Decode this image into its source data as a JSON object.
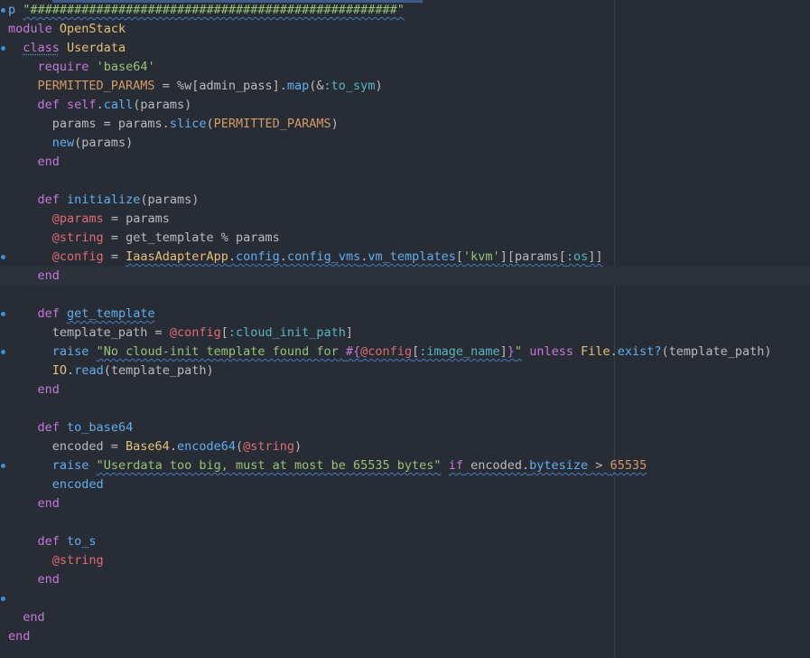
{
  "editor": {
    "language": "ruby",
    "colors": {
      "background": "#282c34",
      "keyword": "#c678dd",
      "string": "#98c379",
      "constant": "#d19a66",
      "class": "#e5c07b",
      "method": "#61afef",
      "ivar": "#e06c75",
      "symbol": "#56b6c2",
      "plain": "#bbbbbb",
      "gutter_marker": "#3d8fdb"
    },
    "lines": [
      {
        "t": [
          {
            "c": "fn",
            "v": "p"
          },
          {
            "c": "plain",
            "v": " "
          },
          {
            "c": "str",
            "v": "\"##################################################\""
          }
        ]
      },
      {
        "t": [
          {
            "c": "kw",
            "v": "module"
          },
          {
            "c": "plain",
            "v": " "
          },
          {
            "c": "cls",
            "v": "OpenStack"
          }
        ]
      },
      {
        "t": [
          {
            "c": "plain",
            "v": "  "
          },
          {
            "c": "kw",
            "v": "class"
          },
          {
            "c": "plain",
            "v": " "
          },
          {
            "c": "cls",
            "v": "Userdata"
          }
        ]
      },
      {
        "t": [
          {
            "c": "plain",
            "v": "    "
          },
          {
            "c": "kw",
            "v": "require"
          },
          {
            "c": "plain",
            "v": " "
          },
          {
            "c": "str",
            "v": "'base64'"
          }
        ]
      },
      {
        "t": [
          {
            "c": "plain",
            "v": "    "
          },
          {
            "c": "const",
            "v": "PERMITTED_PARAMS"
          },
          {
            "c": "plain",
            "v": " = %w["
          },
          {
            "c": "plain",
            "v": "admin_pass"
          },
          {
            "c": "plain",
            "v": "]."
          },
          {
            "c": "fn",
            "v": "map"
          },
          {
            "c": "plain",
            "v": "(&"
          },
          {
            "c": "sym",
            "v": ":to_sym"
          },
          {
            "c": "plain",
            "v": ")"
          }
        ]
      },
      {
        "t": [
          {
            "c": "plain",
            "v": "    "
          },
          {
            "c": "kw",
            "v": "def"
          },
          {
            "c": "plain",
            "v": " "
          },
          {
            "c": "kw",
            "v": "self"
          },
          {
            "c": "plain",
            "v": "."
          },
          {
            "c": "fn",
            "v": "call"
          },
          {
            "c": "plain",
            "v": "(params)"
          }
        ]
      },
      {
        "t": [
          {
            "c": "plain",
            "v": "      params = params."
          },
          {
            "c": "fn",
            "v": "slice"
          },
          {
            "c": "plain",
            "v": "("
          },
          {
            "c": "const",
            "v": "PERMITTED_PARAMS"
          },
          {
            "c": "plain",
            "v": ")"
          }
        ]
      },
      {
        "t": [
          {
            "c": "plain",
            "v": "      "
          },
          {
            "c": "fn",
            "v": "new"
          },
          {
            "c": "plain",
            "v": "(params)"
          }
        ]
      },
      {
        "t": [
          {
            "c": "plain",
            "v": "    "
          },
          {
            "c": "kw",
            "v": "end"
          }
        ]
      },
      {
        "t": []
      },
      {
        "t": [
          {
            "c": "plain",
            "v": "    "
          },
          {
            "c": "kw",
            "v": "def"
          },
          {
            "c": "plain",
            "v": " "
          },
          {
            "c": "fn",
            "v": "initialize"
          },
          {
            "c": "plain",
            "v": "(params)"
          }
        ]
      },
      {
        "t": [
          {
            "c": "plain",
            "v": "      "
          },
          {
            "c": "ivar",
            "v": "@params"
          },
          {
            "c": "plain",
            "v": " = params"
          }
        ]
      },
      {
        "t": [
          {
            "c": "plain",
            "v": "      "
          },
          {
            "c": "ivar",
            "v": "@string"
          },
          {
            "c": "plain",
            "v": " = get_template % params"
          }
        ]
      },
      {
        "t": [
          {
            "c": "plain",
            "v": "      "
          },
          {
            "c": "ivar",
            "v": "@config"
          },
          {
            "c": "plain",
            "v": " = "
          },
          {
            "c": "cls",
            "v": "IaasAdapterApp"
          },
          {
            "c": "plain",
            "v": "."
          },
          {
            "c": "fn",
            "v": "config"
          },
          {
            "c": "plain",
            "v": "."
          },
          {
            "c": "fn",
            "v": "config_vms"
          },
          {
            "c": "plain",
            "v": "."
          },
          {
            "c": "fn",
            "v": "vm_templates"
          },
          {
            "c": "plain",
            "v": "["
          },
          {
            "c": "str",
            "v": "'kvm'"
          },
          {
            "c": "plain",
            "v": "][params["
          },
          {
            "c": "sym",
            "v": ":os"
          },
          {
            "c": "plain",
            "v": "]]"
          }
        ]
      },
      {
        "t": [
          {
            "c": "plain",
            "v": "    "
          },
          {
            "c": "kw",
            "v": "end"
          }
        ]
      },
      {
        "t": []
      },
      {
        "t": [
          {
            "c": "plain",
            "v": "    "
          },
          {
            "c": "kw",
            "v": "def"
          },
          {
            "c": "plain",
            "v": " "
          },
          {
            "c": "fn",
            "v": "get_template"
          }
        ]
      },
      {
        "t": [
          {
            "c": "plain",
            "v": "      template_path = "
          },
          {
            "c": "ivar",
            "v": "@config"
          },
          {
            "c": "plain",
            "v": "["
          },
          {
            "c": "sym",
            "v": ":cloud_init_path"
          },
          {
            "c": "plain",
            "v": "]"
          }
        ]
      },
      {
        "t": [
          {
            "c": "plain",
            "v": "      "
          },
          {
            "c": "fn",
            "v": "raise"
          },
          {
            "c": "plain",
            "v": " "
          },
          {
            "c": "str",
            "v": "\"No cloud-init template found for "
          },
          {
            "c": "interp",
            "v": "#{"
          },
          {
            "c": "ivar",
            "v": "@config"
          },
          {
            "c": "plain",
            "v": "["
          },
          {
            "c": "sym",
            "v": ":image_name"
          },
          {
            "c": "plain",
            "v": "]"
          },
          {
            "c": "interp",
            "v": "}"
          },
          {
            "c": "str",
            "v": "\""
          },
          {
            "c": "plain",
            "v": " "
          },
          {
            "c": "kw",
            "v": "unless"
          },
          {
            "c": "plain",
            "v": " "
          },
          {
            "c": "cls",
            "v": "File"
          },
          {
            "c": "plain",
            "v": "."
          },
          {
            "c": "fn",
            "v": "exist?"
          },
          {
            "c": "plain",
            "v": "(template_path)"
          }
        ]
      },
      {
        "t": [
          {
            "c": "plain",
            "v": "      "
          },
          {
            "c": "cls",
            "v": "IO"
          },
          {
            "c": "plain",
            "v": "."
          },
          {
            "c": "fn",
            "v": "read"
          },
          {
            "c": "plain",
            "v": "(template_path)"
          }
        ]
      },
      {
        "t": [
          {
            "c": "plain",
            "v": "    "
          },
          {
            "c": "kw",
            "v": "end"
          }
        ]
      },
      {
        "t": []
      },
      {
        "t": [
          {
            "c": "plain",
            "v": "    "
          },
          {
            "c": "kw",
            "v": "def"
          },
          {
            "c": "plain",
            "v": " "
          },
          {
            "c": "fn",
            "v": "to_base64"
          }
        ]
      },
      {
        "t": [
          {
            "c": "plain",
            "v": "      encoded = "
          },
          {
            "c": "cls",
            "v": "Base64"
          },
          {
            "c": "plain",
            "v": "."
          },
          {
            "c": "fn",
            "v": "encode64"
          },
          {
            "c": "plain",
            "v": "("
          },
          {
            "c": "ivar",
            "v": "@string"
          },
          {
            "c": "plain",
            "v": ")"
          }
        ]
      },
      {
        "t": [
          {
            "c": "plain",
            "v": "      "
          },
          {
            "c": "fn",
            "v": "raise"
          },
          {
            "c": "plain",
            "v": " "
          },
          {
            "c": "str",
            "v": "\"Userdata too big, must at most be 65535 bytes\""
          },
          {
            "c": "plain",
            "v": " "
          },
          {
            "c": "kw",
            "v": "if"
          },
          {
            "c": "plain",
            "v": " encoded."
          },
          {
            "c": "fn",
            "v": "bytesize"
          },
          {
            "c": "plain",
            "v": " > "
          },
          {
            "c": "num",
            "v": "65535"
          }
        ]
      },
      {
        "t": [
          {
            "c": "plain",
            "v": "      "
          },
          {
            "c": "fn",
            "v": "encoded"
          }
        ]
      },
      {
        "t": [
          {
            "c": "plain",
            "v": "    "
          },
          {
            "c": "kw",
            "v": "end"
          }
        ]
      },
      {
        "t": []
      },
      {
        "t": [
          {
            "c": "plain",
            "v": "    "
          },
          {
            "c": "kw",
            "v": "def"
          },
          {
            "c": "plain",
            "v": " "
          },
          {
            "c": "fn",
            "v": "to_s"
          }
        ]
      },
      {
        "t": [
          {
            "c": "plain",
            "v": "      "
          },
          {
            "c": "ivar",
            "v": "@string"
          }
        ]
      },
      {
        "t": [
          {
            "c": "plain",
            "v": "    "
          },
          {
            "c": "kw",
            "v": "end"
          }
        ]
      },
      {
        "t": []
      },
      {
        "t": [
          {
            "c": "plain",
            "v": "  "
          },
          {
            "c": "kw",
            "v": "end"
          }
        ]
      },
      {
        "t": [
          {
            "c": "kw",
            "v": "end"
          }
        ]
      }
    ],
    "current_line": 14,
    "gutter_markers": [
      0,
      2,
      13,
      16,
      18,
      24,
      31
    ]
  }
}
